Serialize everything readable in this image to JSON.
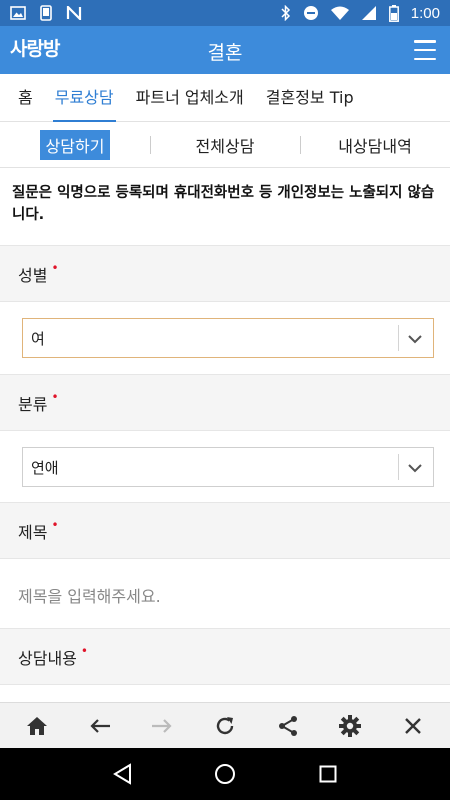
{
  "status_bar": {
    "time": "1:00",
    "left_icons": [
      "image-icon",
      "phone-icon",
      "n-logo-icon"
    ],
    "right_icons": [
      "bluetooth-icon",
      "do-not-disturb-icon",
      "wifi-icon",
      "signal-icon",
      "battery-icon"
    ]
  },
  "app_bar": {
    "logo_text": "사랑방",
    "title": "결혼",
    "menu_icon": "hamburger-icon"
  },
  "main_tabs": [
    {
      "label": "홈",
      "active": false
    },
    {
      "label": "무료상담",
      "active": true
    },
    {
      "label": "파트너 업체소개",
      "active": false
    },
    {
      "label": "결혼정보 Tip",
      "active": false
    }
  ],
  "sub_tabs": [
    {
      "label": "상담하기",
      "active": true
    },
    {
      "label": "전체상담",
      "active": false
    },
    {
      "label": "내상담내역",
      "active": false
    }
  ],
  "notice": "질문은 익명으로 등록되며 휴대전화번호 등 개인정보는 노출되지 않습니다.",
  "form": {
    "required_mark": "•",
    "gender_label": "성별",
    "gender_value": "여",
    "category_label": "분류",
    "category_value": "연애",
    "subject_label": "제목",
    "subject_placeholder": "제목을 입력해주세요.",
    "content_label": "상담내용"
  },
  "toolbar": {
    "icons": [
      "home-icon",
      "back-arrow-icon",
      "forward-arrow-icon",
      "refresh-icon",
      "share-icon",
      "settings-icon",
      "close-icon"
    ]
  },
  "nav_bar": {
    "icons": [
      "nav-back-icon",
      "nav-home-icon",
      "nav-recents-icon"
    ]
  },
  "colors": {
    "status_bar": "#2e6fb8",
    "app_bar": "#3d8bdb",
    "accent": "#2f7ed3",
    "required": "#e0142a"
  }
}
